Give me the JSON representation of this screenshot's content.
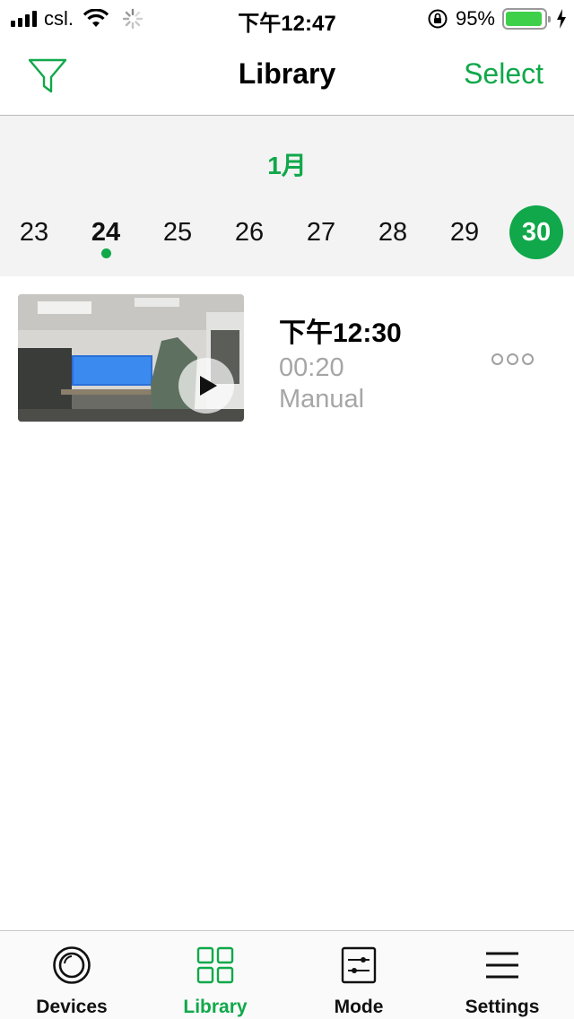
{
  "status_bar": {
    "carrier": "csl.",
    "time": "下午12:47",
    "battery_percent": "95%",
    "battery_level": 0.95
  },
  "nav": {
    "title": "Library",
    "select_label": "Select",
    "filter_icon": "filter-icon"
  },
  "calendar": {
    "month": "1月",
    "days": [
      "23",
      "24",
      "25",
      "26",
      "27",
      "28",
      "29",
      "30"
    ],
    "selected_day": "30",
    "marked_day": "24"
  },
  "clips": [
    {
      "time": "下午12:30",
      "duration": "00:20",
      "type": "Manual"
    }
  ],
  "tabs": [
    {
      "label": "Devices",
      "icon": "camera-lens-icon",
      "active": false
    },
    {
      "label": "Library",
      "icon": "grid-icon",
      "active": true
    },
    {
      "label": "Mode",
      "icon": "sliders-icon",
      "active": false
    },
    {
      "label": "Settings",
      "icon": "menu-icon",
      "active": false
    }
  ],
  "colors": {
    "accent": "#10a84a",
    "background_strip": "#f3f3f3",
    "muted_text": "#a6a6a6"
  }
}
